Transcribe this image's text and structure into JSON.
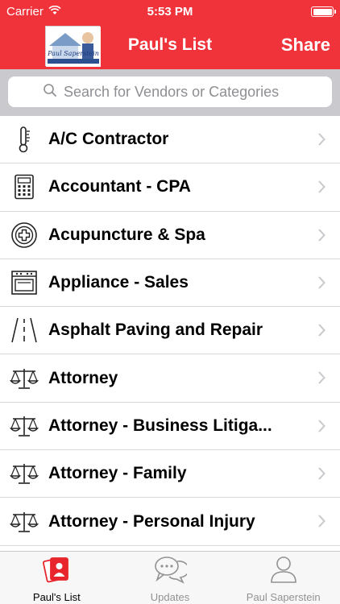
{
  "status_bar": {
    "carrier": "Carrier",
    "time": "5:53 PM"
  },
  "nav": {
    "title": "Paul's List",
    "share_label": "Share",
    "logo_text": "Paul Saperstein"
  },
  "search": {
    "placeholder": "Search for Vendors or Categories"
  },
  "categories": [
    {
      "label": "A/C Contractor",
      "icon": "thermometer-icon"
    },
    {
      "label": "Accountant - CPA",
      "icon": "calculator-icon"
    },
    {
      "label": "Acupuncture & Spa",
      "icon": "medical-cross-icon"
    },
    {
      "label": "Appliance - Sales",
      "icon": "oven-icon"
    },
    {
      "label": "Asphalt Paving and Repair",
      "icon": "road-icon"
    },
    {
      "label": "Attorney",
      "icon": "scales-icon"
    },
    {
      "label": "Attorney - Business Litiga...",
      "icon": "scales-icon"
    },
    {
      "label": "Attorney - Family",
      "icon": "scales-icon"
    },
    {
      "label": "Attorney - Personal Injury",
      "icon": "scales-icon"
    }
  ],
  "tabs": [
    {
      "label": "Paul's List",
      "icon": "contacts-cards-icon",
      "active": true
    },
    {
      "label": "Updates",
      "icon": "chat-bubbles-icon",
      "active": false
    },
    {
      "label": "Paul Saperstein",
      "icon": "person-icon",
      "active": false
    }
  ],
  "colors": {
    "brand_red": "#f0333b",
    "search_bg": "#c9c9ce",
    "tab_bar_bg": "#f7f7f7"
  }
}
